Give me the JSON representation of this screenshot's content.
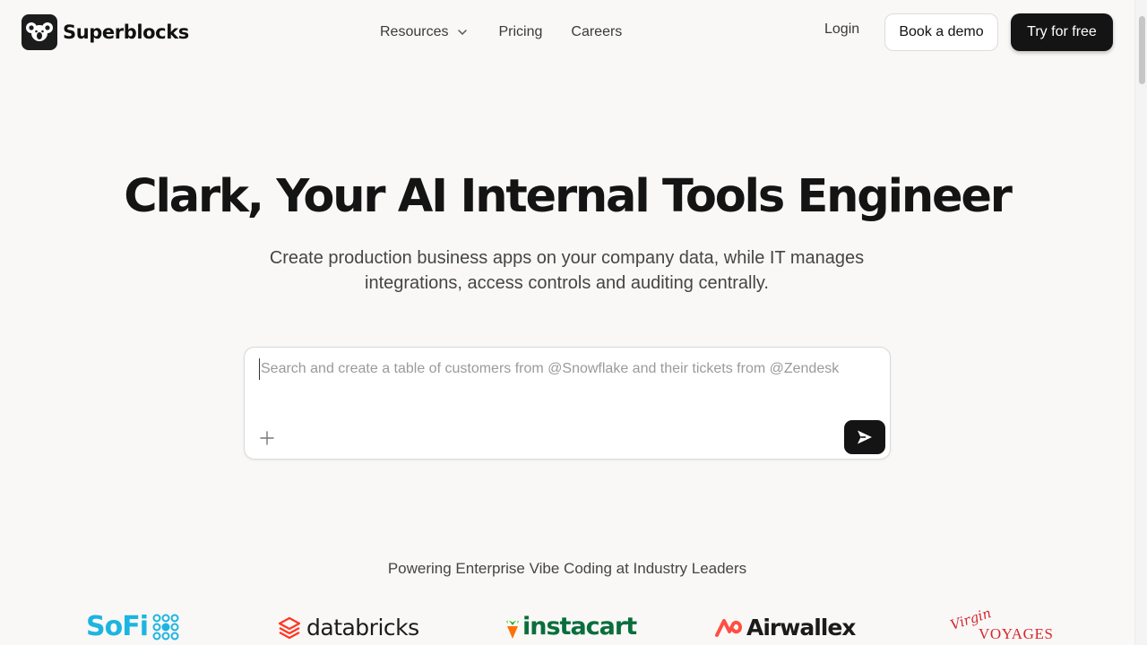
{
  "brand": {
    "name": "Superblocks",
    "logo_icon": "koala-icon"
  },
  "nav": {
    "resources": "Resources",
    "pricing": "Pricing",
    "careers": "Careers"
  },
  "actions": {
    "login": "Login",
    "book_demo": "Book a demo",
    "try_free": "Try for free"
  },
  "hero": {
    "title": "Clark, Your AI Internal Tools Engineer",
    "subtitle": "Create production business apps on your company data, while IT manages integrations, access controls and auditing centrally."
  },
  "prompt": {
    "placeholder": "Search and create a table of customers from @Snowflake and their tickets from @Zendesk",
    "value": "",
    "add_icon": "plus-icon",
    "send_icon": "send-arrow-icon"
  },
  "customers": {
    "heading": "Powering Enterprise Vibe Coding at Industry Leaders",
    "logos": [
      {
        "name": "SoFi",
        "color": "#1cb5e0"
      },
      {
        "name": "databricks",
        "color": "#ff3621"
      },
      {
        "name": "instacart",
        "color": "#0a6e3c"
      },
      {
        "name": "Airwallex",
        "color": "#ff4f42"
      },
      {
        "name": "Virgin",
        "sub": "VOYAGES",
        "color": "#d7262c"
      }
    ]
  },
  "colors": {
    "background": "#f9f8f7",
    "primary_button": "#141414",
    "text": "#141414"
  }
}
